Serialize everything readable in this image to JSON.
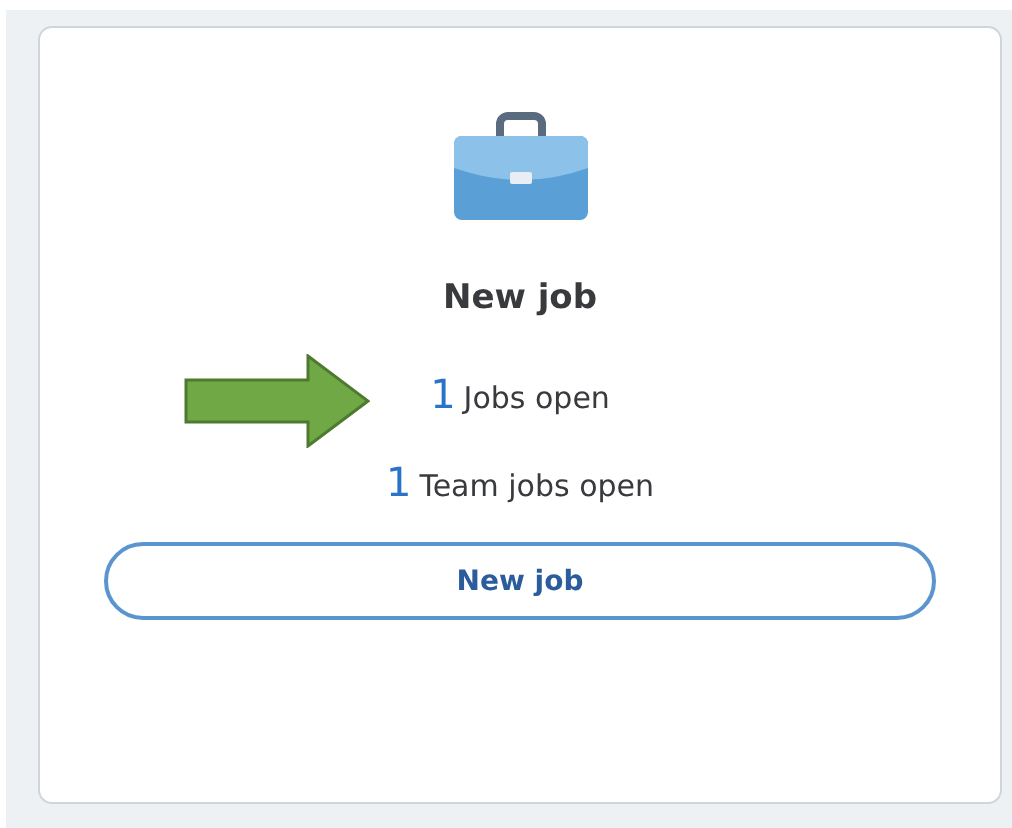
{
  "card": {
    "title": "New job",
    "stats": [
      {
        "count": "1",
        "label": "Jobs open",
        "annotated": true
      },
      {
        "count": "1",
        "label": "Team jobs open",
        "annotated": false
      }
    ],
    "button": "New job"
  }
}
